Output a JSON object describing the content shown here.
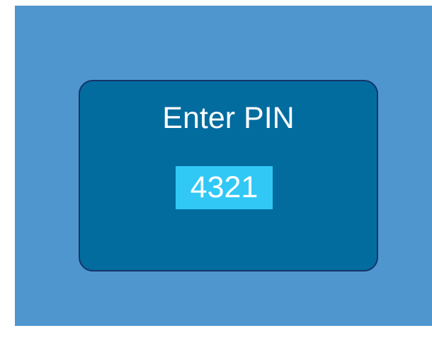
{
  "colors": {
    "background": "#4f96cf",
    "dialog": "#036c9f",
    "input": "#31c8f6"
  },
  "dialog": {
    "title": "Enter PIN",
    "pin_value": "4321"
  }
}
